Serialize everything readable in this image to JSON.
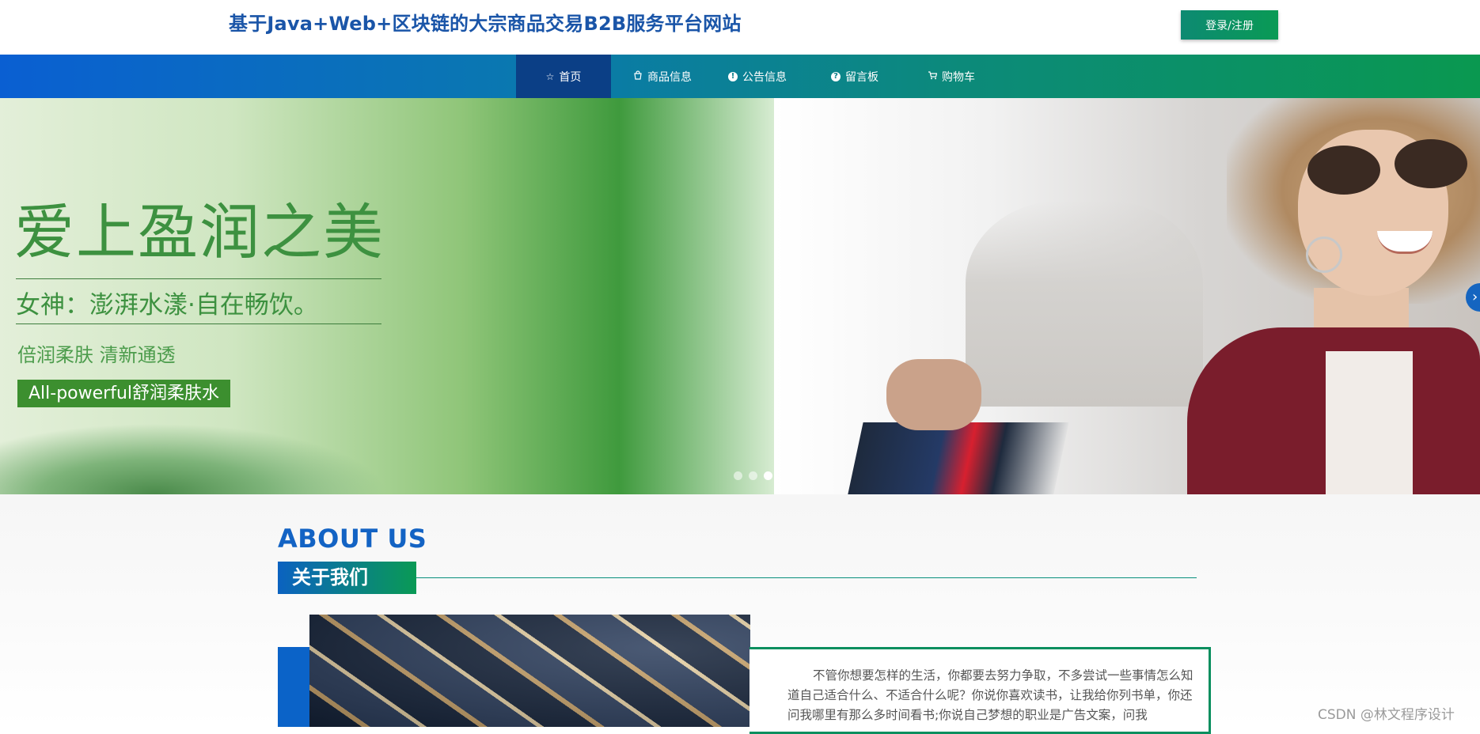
{
  "header": {
    "site_title": "基于Java+Web+区块链的大宗商品交易B2B服务平台网站",
    "login_label": "登录/注册"
  },
  "nav": {
    "items": [
      {
        "label": "首页",
        "icon": "star-icon",
        "active": true
      },
      {
        "label": "商品信息",
        "icon": "bag-icon",
        "active": false
      },
      {
        "label": "公告信息",
        "icon": "info-icon",
        "active": false
      },
      {
        "label": "留言板",
        "icon": "question-icon",
        "active": false
      },
      {
        "label": "购物车",
        "icon": "cart-icon",
        "active": false
      }
    ]
  },
  "banner": {
    "slogan": "爱上盈润之美",
    "subline": "女神：澎湃水漾·自在畅饮。",
    "subline2": "倍润柔肤 清新通透",
    "tagline": "All-powerful舒润柔肤水",
    "slide_count": 3,
    "active_slide": 3,
    "next_icon": "chevron-right-icon"
  },
  "about": {
    "title_en": "ABOUT US",
    "title_cn": "关于我们",
    "paragraph": "不管你想要怎样的生活，你都要去努力争取，不多尝试一些事情怎么知道自己适合什么、不适合什么呢？你说你喜欢读书，让我给你列书单，你还问我哪里有那么多时间看书;你说自己梦想的职业是广告文案，问我"
  },
  "watermark": "CSDN @林文程序设计",
  "colors": {
    "brand_blue": "#1a55a8",
    "nav_start": "#0a5fd2",
    "nav_end": "#0a9850",
    "accent_green": "#0a9a55"
  }
}
